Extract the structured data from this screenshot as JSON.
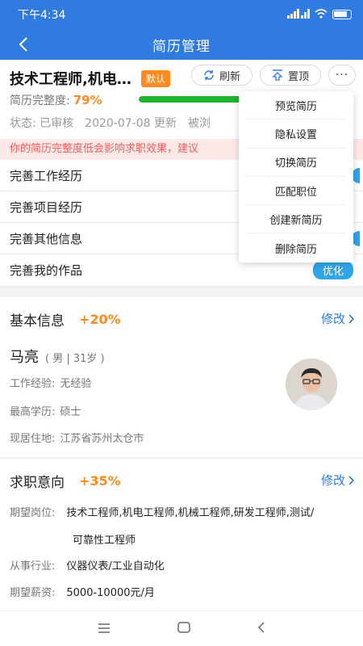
{
  "status_bar": {
    "time": "下午4:34",
    "network": "4G"
  },
  "navbar": {
    "title": "简历管理"
  },
  "resume": {
    "title": "技术工程师,机电…",
    "badge": "默认",
    "refresh_label": "刷新",
    "top_label": "置顶",
    "more_label": "···",
    "completeness_label": "简历完整度:",
    "completeness_value": "79%",
    "completeness_fraction": 0.79,
    "status_label": "状态:",
    "status_value": "已审核",
    "updated": "2020-07-08 更新",
    "viewed": "被浏",
    "warning": "你的简历完整度低会影响求职效果，建议"
  },
  "todo": [
    {
      "label": "完善工作经历"
    },
    {
      "label": "完善项目经历"
    },
    {
      "label": "完善其他信息"
    },
    {
      "label": "完善我的作品",
      "tag": "优化"
    }
  ],
  "menu": [
    "预览简历",
    "隐私设置",
    "切换简历",
    "匹配职位",
    "创建新简历",
    "删除简历"
  ],
  "basic": {
    "title": "基本信息",
    "bonus": "+20%",
    "edit": "修改",
    "name": "马亮",
    "meta": "( 男 | 31岁 )",
    "experience_label": "工作经验:",
    "experience_value": "无经验",
    "education_label": "最高学历:",
    "education_value": "硕士",
    "residence_label": "现居住地:",
    "residence_value": "江苏省苏州太仓市"
  },
  "intent": {
    "title": "求职意向",
    "bonus": "+35%",
    "edit": "修改",
    "position_label": "期望岗位:",
    "position_value_line1": "技术工程师,机电工程师,机械工程师,研发工程师,测试/",
    "position_value_line2": "可靠性工程师",
    "industry_label": "从事行业:",
    "industry_value": "仪器仪表/工业自动化",
    "salary_label": "期望薪资:",
    "salary_value": "5000-10000元/月"
  }
}
